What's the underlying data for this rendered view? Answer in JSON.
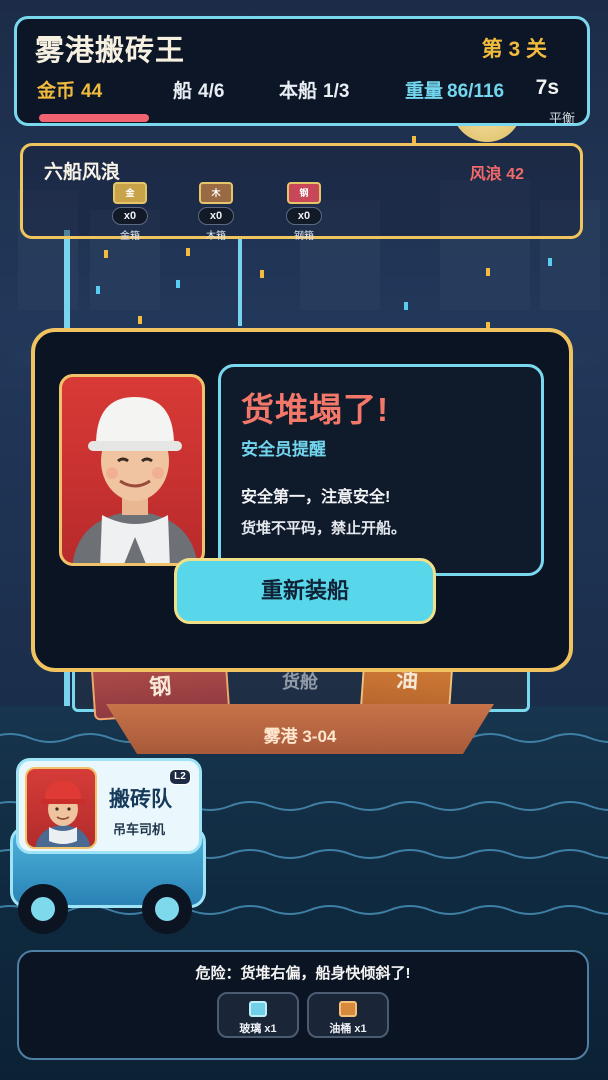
{
  "header": {
    "title": "雾港搬砖王",
    "level": "第 3 关",
    "coins_label": "金币",
    "coins": "44",
    "ships_label": "船",
    "ships": "4/6",
    "this_ship_label": "本船",
    "this_ship": "1/3",
    "weight_label": "重量",
    "weight": "86/116",
    "timer": "7s",
    "balance_label": "平衡",
    "hp_fraction": 0.25
  },
  "wave_panel": {
    "title": "六船风浪",
    "wind": "风浪 42",
    "cargo": [
      {
        "chip": "金",
        "count": "x0",
        "name": "金箱",
        "color": "#c9a34a"
      },
      {
        "chip": "木",
        "count": "x0",
        "name": "木箱",
        "color": "#9a6a44"
      },
      {
        "chip": "钢",
        "count": "x0",
        "name": "钢箱",
        "color": "#c8485a"
      }
    ]
  },
  "ship": {
    "label": "雾港 3-04",
    "hold_label": "货舱",
    "crate_steel": "钢",
    "crate_oil": "油"
  },
  "modal": {
    "title": "货堆塌了!",
    "subtitle": "安全员提醒",
    "line1": "安全第一，注意安全!",
    "line2": "货堆不平码，禁止开船。",
    "button": "重新装船"
  },
  "crew": {
    "name": "搬砖队",
    "role": "吊车司机",
    "level": "L2"
  },
  "bottom": {
    "danger": "危险：货堆右偏，船身快倾斜了!",
    "items": [
      {
        "label": "玻璃 x1",
        "icon": "glass-icon",
        "color": "#6fd0e8"
      },
      {
        "label": "油桶 x1",
        "icon": "oil-barrel-icon",
        "color": "#d88a3c"
      }
    ]
  },
  "colors": {
    "accent_cyan": "#7ad8ee",
    "accent_gold": "#f1c260",
    "danger_red": "#f4786a",
    "button_cyan": "#58d7ea"
  }
}
